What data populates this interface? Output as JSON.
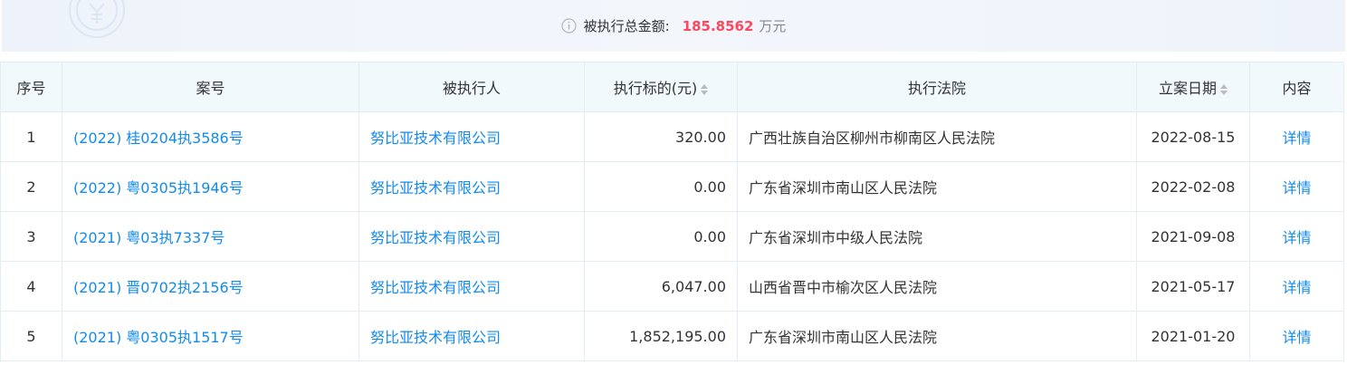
{
  "summary": {
    "label": "被执行总金额:",
    "amount": "185.8562",
    "unit": "万元"
  },
  "table": {
    "headers": {
      "index": "序号",
      "case_no": "案号",
      "executee": "被执行人",
      "target": "执行标的(元)",
      "court": "执行法院",
      "date": "立案日期",
      "content": "内容"
    },
    "rows": [
      {
        "index": "1",
        "case_no": "(2022) 桂0204执3586号",
        "executee": "努比亚技术有限公司",
        "target": "320.00",
        "court": "广西壮族自治区柳州市柳南区人民法院",
        "date": "2022-08-15",
        "content": "详情"
      },
      {
        "index": "2",
        "case_no": "(2022) 粤0305执1946号",
        "executee": "努比亚技术有限公司",
        "target": "0.00",
        "court": "广东省深圳市南山区人民法院",
        "date": "2022-02-08",
        "content": "详情"
      },
      {
        "index": "3",
        "case_no": "(2021) 粤03执7337号",
        "executee": "努比亚技术有限公司",
        "target": "0.00",
        "court": "广东省深圳市中级人民法院",
        "date": "2021-09-08",
        "content": "详情"
      },
      {
        "index": "4",
        "case_no": "(2021) 晋0702执2156号",
        "executee": "努比亚技术有限公司",
        "target": "6,047.00",
        "court": "山西省晋中市榆次区人民法院",
        "date": "2021-05-17",
        "content": "详情"
      },
      {
        "index": "5",
        "case_no": "(2021) 粤0305执1517号",
        "executee": "努比亚技术有限公司",
        "target": "1,852,195.00",
        "court": "广东省深圳市南山区人民法院",
        "date": "2021-01-20",
        "content": "详情"
      }
    ]
  },
  "colors": {
    "link": "#128bed",
    "amount": "#fd485e",
    "header_bg": "#f2f9fc"
  }
}
